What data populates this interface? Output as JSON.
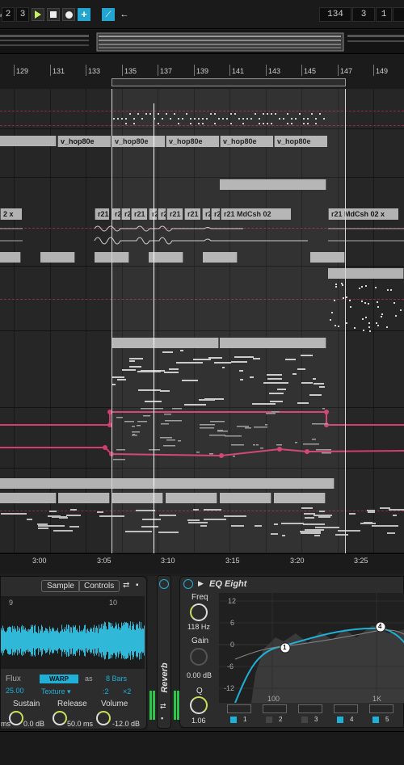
{
  "transport": {
    "quantize_value": "2",
    "bar_value": "3",
    "position": [
      "134",
      "3",
      "1"
    ]
  },
  "ruler": {
    "bars": [
      "129",
      "131",
      "133",
      "135",
      "137",
      "139",
      "141",
      "143",
      "145",
      "147",
      "149"
    ]
  },
  "clips": {
    "hop_clip": "v_hop80e",
    "mdcsh_short": "r21",
    "mdcsh_short2": "r2",
    "mdcsh_long": "r21 MdCsh 02",
    "mdcsh_left": "2 x",
    "mdcsh_right": "r21 MdCsh 02 x"
  },
  "timeline": {
    "labels": [
      "3:00",
      "3:05",
      "3:10",
      "3:15",
      "3:20",
      "3:25"
    ]
  },
  "sampler": {
    "tab_sample": "Sample",
    "tab_controls": "Controls",
    "wave_markers": [
      "9",
      "10"
    ],
    "flux_label": "Flux",
    "flux_value": "25.00",
    "warp_label": "WARP",
    "as_label": "as",
    "bars_value": "8 Bars",
    "texture": "Texture ▾",
    "div2": ":2",
    "mul2": "×2",
    "sustain_label": "Sustain",
    "sustain_value": "0.0 dB",
    "release_label": "Release",
    "release_value": "50.0 ms",
    "volume_label": "Volume",
    "volume_value": "-12.0 dB",
    "left_ms": "ms"
  },
  "reverb": {
    "label": "Reverb"
  },
  "eq": {
    "title": "EQ Eight",
    "freq_label": "Freq",
    "freq_value": "118 Hz",
    "gain_label": "Gain",
    "gain_value": "0.00 dB",
    "q_label": "Q",
    "q_value": "1.06",
    "y_ticks": [
      "12",
      "6",
      "0",
      "-6",
      "-12"
    ],
    "x_ticks": [
      "100",
      "1K"
    ],
    "bands": [
      {
        "num": "1",
        "on": true
      },
      {
        "num": "2",
        "on": false
      },
      {
        "num": "3",
        "on": false
      },
      {
        "num": "4",
        "on": true
      },
      {
        "num": "5",
        "on": true
      }
    ],
    "markers": [
      "1",
      "4"
    ]
  },
  "colors": {
    "accent_blue": "#1fb0d8",
    "automation_pink": "#d23c6e",
    "play_green": "#c6f25d",
    "clip_grey": "#b2b2b2"
  }
}
